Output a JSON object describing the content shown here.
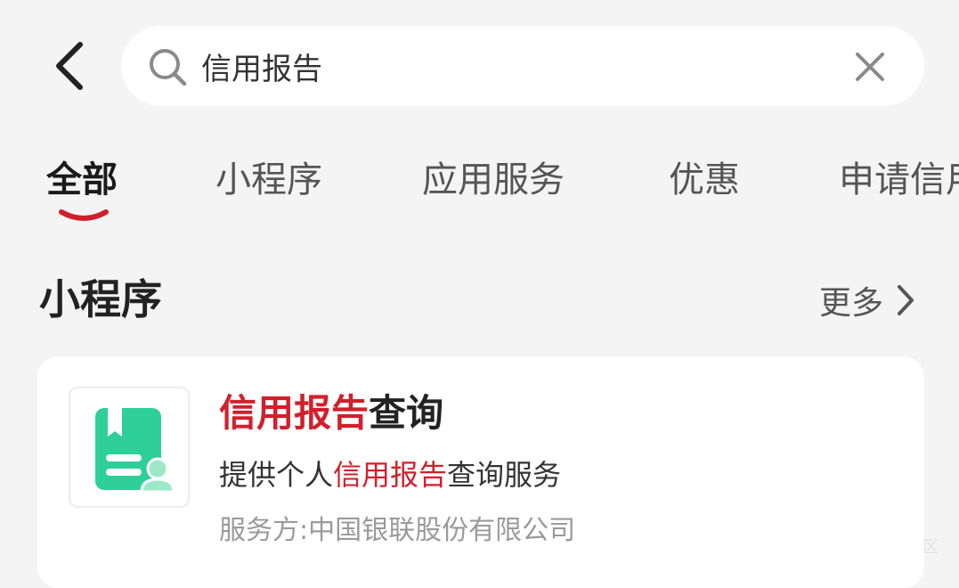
{
  "search": {
    "query": "信用报告"
  },
  "tabs": [
    {
      "label": "全部",
      "active": true
    },
    {
      "label": "小程序",
      "active": false
    },
    {
      "label": "应用服务",
      "active": false
    },
    {
      "label": "优惠",
      "active": false
    },
    {
      "label": "申请信用",
      "active": false
    }
  ],
  "section": {
    "title": "小程序",
    "more_label": "更多"
  },
  "result": {
    "title_highlight": "信用报告",
    "title_rest": "查询",
    "desc_prefix": "提供个人",
    "desc_highlight": "信用报告",
    "desc_suffix": "查询服务",
    "provider": "服务方:中国银联股份有限公司"
  },
  "corner_mark": "区",
  "icons": {
    "back": "chevron-left-icon",
    "search": "search-icon",
    "clear": "close-icon",
    "more": "chevron-right-icon",
    "app": "credit-report-book-icon"
  },
  "colors": {
    "highlight": "#d21f2b",
    "accent_underline": "#d21f2b",
    "app_icon_green": "#2fcf9a",
    "app_icon_green_light": "#9ee8c8",
    "background": "#f4f4f4"
  }
}
